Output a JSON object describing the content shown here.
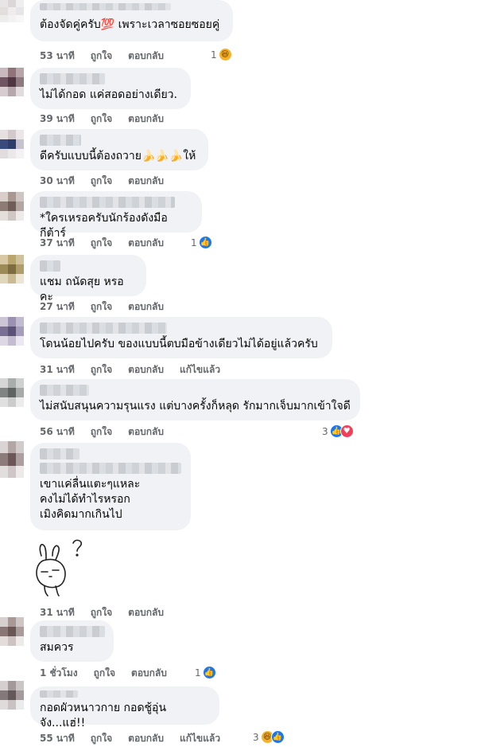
{
  "comments": [
    {
      "text": "ต้องจัดคู่ครับ💯 เพราะเวลาซอยซอยคู่",
      "time": "53 นาที",
      "like": "ถูกใจ",
      "reply": "ตอบกลับ",
      "edited": "",
      "react_count": "1",
      "reacts": [
        "haha-icon"
      ]
    },
    {
      "text": "ไม่ได้กอด แค่สอดอย่างเดียว.",
      "time": "39 นาที",
      "like": "ถูกใจ",
      "reply": "ตอบกลับ",
      "edited": "",
      "react_count": "",
      "reacts": []
    },
    {
      "text": "ดีครับแบบนี้ต้องถวาย🍌🍌🍌ให้",
      "time": "30 นาที",
      "like": "ถูกใจ",
      "reply": "ตอบกลับ",
      "edited": "",
      "react_count": "",
      "reacts": []
    },
    {
      "text": "*ใครเหรอครับนักร้องดังมือกีต้าร์",
      "time": "37 นาที",
      "like": "ถูกใจ",
      "reply": "ตอบกลับ",
      "edited": "",
      "react_count": "1",
      "reacts": [
        "like-icon"
      ]
    },
    {
      "text": "แชม ถนัดสุย หรอคะ",
      "time": "27 นาที",
      "like": "ถูกใจ",
      "reply": "ตอบกลับ",
      "edited": "",
      "react_count": "",
      "reacts": []
    },
    {
      "text": "โดนน้อยไปครับ ของแบบนี้ตบมือข้างเดียวไม่ได้อยู่แล้วครับ",
      "time": "31 นาที",
      "like": "ถูกใจ",
      "reply": "ตอบกลับ",
      "edited": "แก้ไขแล้ว",
      "react_count": "",
      "reacts": []
    },
    {
      "text": "ไม่สนับสนุนความรุนแรง แต่บางครั้งก็หลุด รักมากเจ็บมากเข้าใจดี",
      "time": "56 นาที",
      "like": "ถูกใจ",
      "reply": "ตอบกลับ",
      "edited": "",
      "react_count": "3",
      "reacts": [
        "like-icon",
        "love-icon"
      ]
    },
    {
      "text": "เขาแค่ลื่นแตะๆแหละ\nคงไม่ได้ทำไรหรอก\nเมิงคิดมากเกินไป",
      "time": "31 นาที",
      "like": "ถูกใจ",
      "reply": "ตอบกลับ",
      "edited": "",
      "react_count": "",
      "reacts": []
    },
    {
      "text": "สมควร",
      "time": "1 ชั่วโมง",
      "like": "ถูกใจ",
      "reply": "ตอบกลับ",
      "edited": "",
      "react_count": "1",
      "reacts": [
        "like-icon"
      ]
    },
    {
      "text": "กอดผัวหนาวกาย กอดชู้อุ่นจัง...แฮ่!!",
      "time": "55 นาที",
      "like": "ถูกใจ",
      "reply": "ตอบกลับ",
      "edited": "แก้ไขแล้ว",
      "react_count": "3",
      "reacts": [
        "haha-icon",
        "like-icon"
      ]
    }
  ]
}
